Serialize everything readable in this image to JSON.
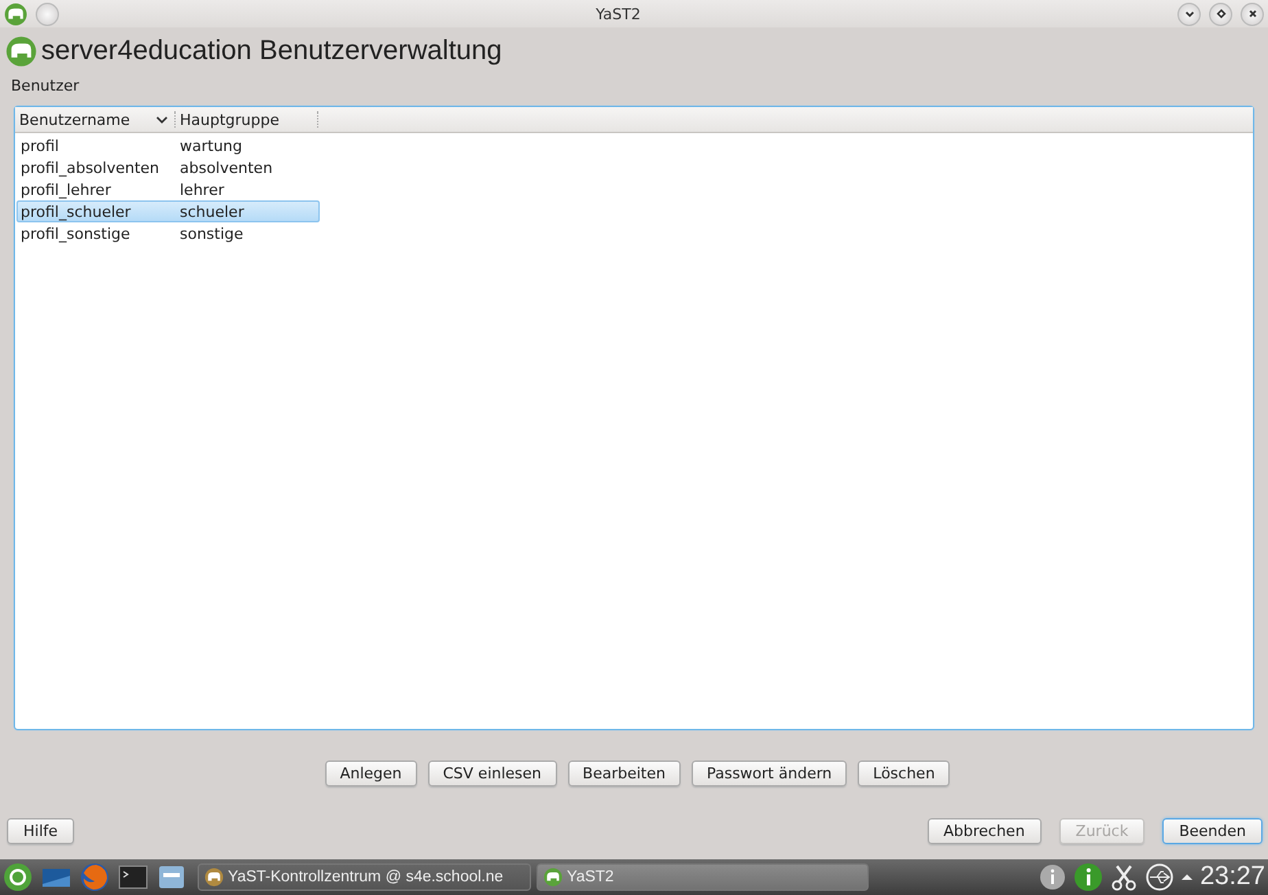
{
  "window": {
    "title": "YaST2"
  },
  "heading": "server4education Benutzerverwaltung",
  "table": {
    "label": "Benutzer",
    "columns": [
      {
        "label": "Benutzername",
        "sorted": true
      },
      {
        "label": "Hauptgruppe",
        "sorted": false
      }
    ],
    "rows": [
      {
        "cells": [
          "profil",
          "wartung"
        ],
        "selected": false
      },
      {
        "cells": [
          "profil_absolventen",
          "absolventen"
        ],
        "selected": false
      },
      {
        "cells": [
          "profil_lehrer",
          "lehrer"
        ],
        "selected": false
      },
      {
        "cells": [
          "profil_schueler",
          "schueler"
        ],
        "selected": true
      },
      {
        "cells": [
          "profil_sonstige",
          "sonstige"
        ],
        "selected": false
      }
    ]
  },
  "actions": [
    {
      "label": "Anlegen"
    },
    {
      "label": "CSV einlesen"
    },
    {
      "label": "Bearbeiten"
    },
    {
      "label": "Passwort ändern"
    },
    {
      "label": "Löschen"
    }
  ],
  "help_button": {
    "label": "Hilfe"
  },
  "footer": [
    {
      "label": "Abbrechen",
      "disabled": false,
      "default": false
    },
    {
      "label": "Zurück",
      "disabled": true,
      "default": false
    },
    {
      "label": "Beenden",
      "disabled": false,
      "default": true
    }
  ],
  "taskbar": {
    "tasks": [
      {
        "label": "YaST-Kontrollzentrum @ s4e.school.ne",
        "selected": false
      },
      {
        "label": "YaST2",
        "selected": true
      }
    ],
    "clock": "23:27"
  }
}
